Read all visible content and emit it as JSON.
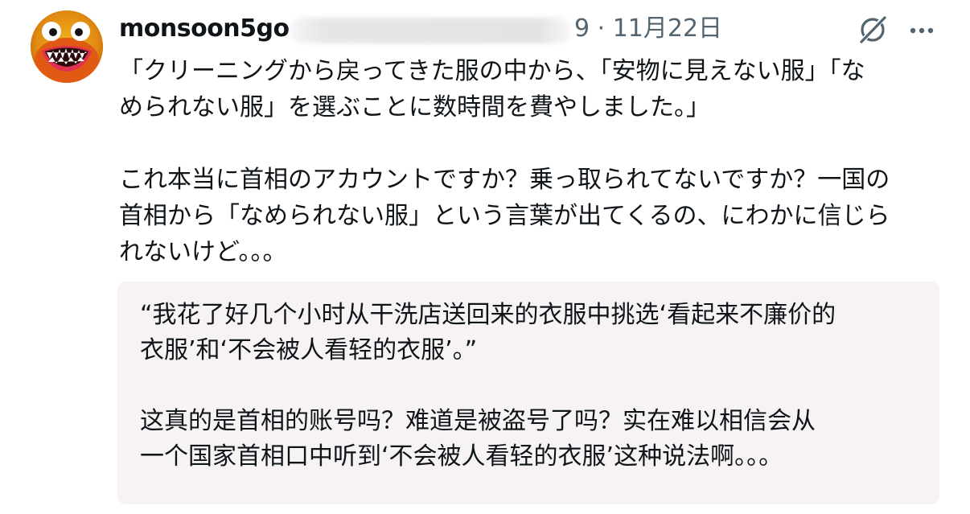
{
  "post": {
    "author": {
      "username": "monsoon5go",
      "avatar_icon": "monster-avatar-icon"
    },
    "date": "9 · 11月22日",
    "actions": {
      "grok_icon": "grok-icon",
      "more_icon": "more-icon"
    },
    "text": {
      "paragraph_1": "「クリーニングから戻ってきた服の中から、「安物に見えない服」「な\nめられない服」を選ぶことに数時間を費やしました。」",
      "paragraph_2": "これ本当に首相のアカウントですか？乗っ取られてないですか？一国の\n首相から「なめられない服」という言葉が出てくるの、にわかに信じら\nれないけど。。。"
    },
    "translation": {
      "paragraph_1": "“我花了好几个小时从干洗店送回来的衣服中挑选‘看起来不廉价的\n衣服’和‘不会被人看轻的衣服’。”",
      "paragraph_2": "这真的是首相的账号吗？难道是被盗号了吗？实在难以相信会从\n一个国家首相口中听到‘不会被人看轻的衣服’这种说法啊。。。"
    }
  },
  "colors": {
    "text_primary": "#0f1419",
    "text_secondary": "#536471",
    "translation_bg": "#f7f3f4"
  }
}
